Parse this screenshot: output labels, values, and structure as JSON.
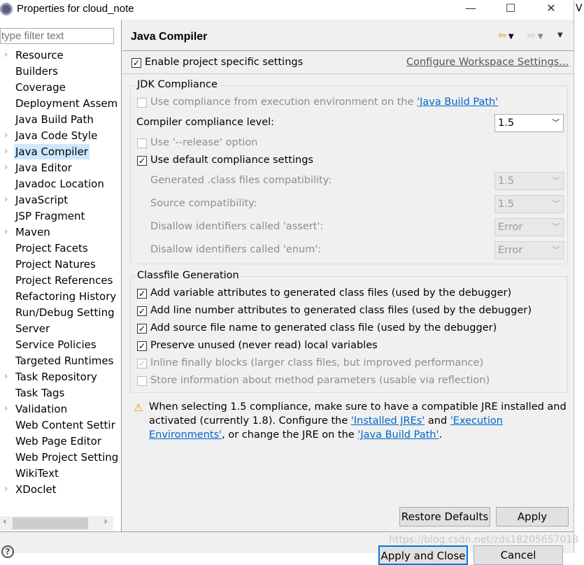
{
  "window": {
    "title": "Properties for cloud_note",
    "minimize": "—",
    "maximize": "☐",
    "close": "✕",
    "behind_text": "V"
  },
  "sidebar": {
    "filter_placeholder": "type filter text",
    "items": [
      {
        "label": "Resource",
        "expandable": true
      },
      {
        "label": "Builders"
      },
      {
        "label": "Coverage"
      },
      {
        "label": "Deployment Assem"
      },
      {
        "label": "Java Build Path"
      },
      {
        "label": "Java Code Style",
        "expandable": true
      },
      {
        "label": "Java Compiler",
        "expandable": true,
        "selected": true
      },
      {
        "label": "Java Editor",
        "expandable": true
      },
      {
        "label": "Javadoc Location"
      },
      {
        "label": "JavaScript",
        "expandable": true
      },
      {
        "label": "JSP Fragment"
      },
      {
        "label": "Maven",
        "expandable": true
      },
      {
        "label": "Project Facets"
      },
      {
        "label": "Project Natures"
      },
      {
        "label": "Project References"
      },
      {
        "label": "Refactoring History"
      },
      {
        "label": "Run/Debug Setting"
      },
      {
        "label": "Server"
      },
      {
        "label": "Service Policies"
      },
      {
        "label": "Targeted Runtimes"
      },
      {
        "label": "Task Repository",
        "expandable": true
      },
      {
        "label": "Task Tags"
      },
      {
        "label": "Validation",
        "expandable": true
      },
      {
        "label": "Web Content Settir"
      },
      {
        "label": "Web Page Editor"
      },
      {
        "label": "Web Project Setting"
      },
      {
        "label": "WikiText"
      },
      {
        "label": "XDoclet",
        "expandable": true
      }
    ],
    "scroll_left": "‹",
    "scroll_right": "›"
  },
  "main": {
    "title": "Java Compiler",
    "enable_project": {
      "label": "Enable project specific settings",
      "checked": true
    },
    "configure_link": "Configure Workspace Settings...",
    "jdk": {
      "group": "JDK Compliance",
      "use_ee": {
        "prefix": "Use compliance from execution environment on the ",
        "link": "'Java Build Path'",
        "checked": false
      },
      "level_label": "Compiler compliance level:",
      "level_value": "1.5",
      "release": {
        "label": "Use '--release' option",
        "checked": false
      },
      "default": {
        "label": "Use default compliance settings",
        "checked": true
      },
      "rows": [
        {
          "label": "Generated .class files compatibility:",
          "value": "1.5"
        },
        {
          "label": "Source compatibility:",
          "value": "1.5"
        },
        {
          "label": "Disallow identifiers called 'assert':",
          "value": "Error"
        },
        {
          "label": "Disallow identifiers called 'enum':",
          "value": "Error"
        }
      ]
    },
    "classfile": {
      "group": "Classfile Generation",
      "options": [
        {
          "label": "Add variable attributes to generated class files (used by the debugger)",
          "checked": true
        },
        {
          "label": "Add line number attributes to generated class files (used by the debugger)",
          "checked": true
        },
        {
          "label": "Add source file name to generated class file (used by the debugger)",
          "checked": true
        },
        {
          "label": "Preserve unused (never read) local variables",
          "checked": true
        },
        {
          "label": "Inline finally blocks (larger class files, but improved performance)",
          "checked": true,
          "disabled": true
        },
        {
          "label": "Store information about method parameters (usable via reflection)",
          "checked": false,
          "disabled": true
        }
      ]
    },
    "warning": {
      "line1": "When selecting 1.5 compliance, make sure to have a compatible JRE installed and",
      "line2a": "activated (currently 1.8). Configure the ",
      "link1": "'Installed JREs'",
      "and": " and ",
      "link2a": "'Execution",
      "link2b": "Environments'",
      "line3": ", or change the JRE on the ",
      "link3": "'Java Build Path'",
      "end": "."
    },
    "restore": "Restore Defaults",
    "apply": "Apply"
  },
  "footer": {
    "help": "?",
    "apply_close": "Apply and Close",
    "cancel": "Cancel",
    "watermark": "https://blog.csdn.net/zds18205657018"
  }
}
